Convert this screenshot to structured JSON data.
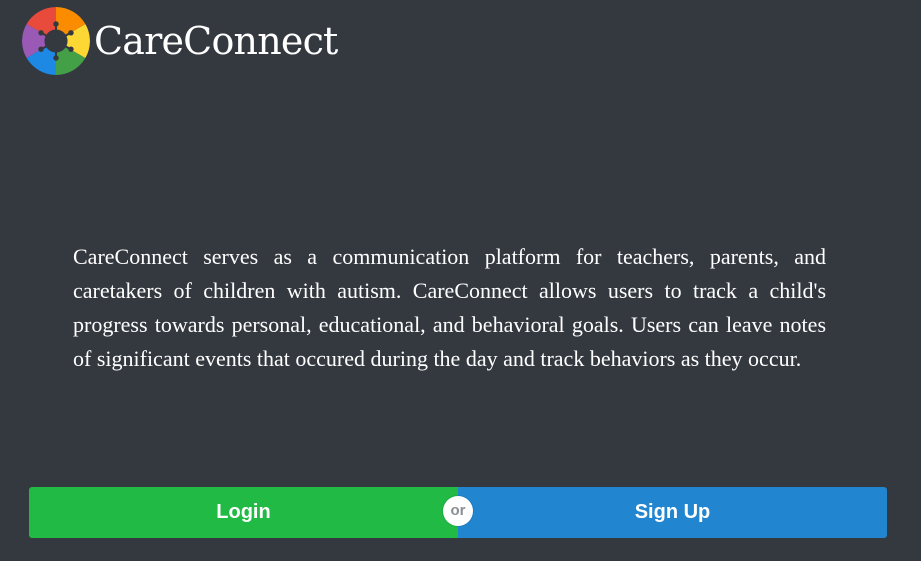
{
  "brand": {
    "name": "CareConnect",
    "logo_icon": "puzzle-piece-people-logo-icon"
  },
  "description": "CareConnect serves as a communication platform for teachers, parents, and caretakers of children with autism. CareConnect allows users to track a child's progress towards personal, educational, and behavioral goals. Users can leave notes of significant events that occured during the day and track behaviors as they occur.",
  "actions": {
    "login_label": "Login",
    "divider_label": "or",
    "signup_label": "Sign Up"
  },
  "colors": {
    "background": "#343940",
    "login": "#21ba45",
    "signup": "#2185d0",
    "text": "#ffffff"
  }
}
